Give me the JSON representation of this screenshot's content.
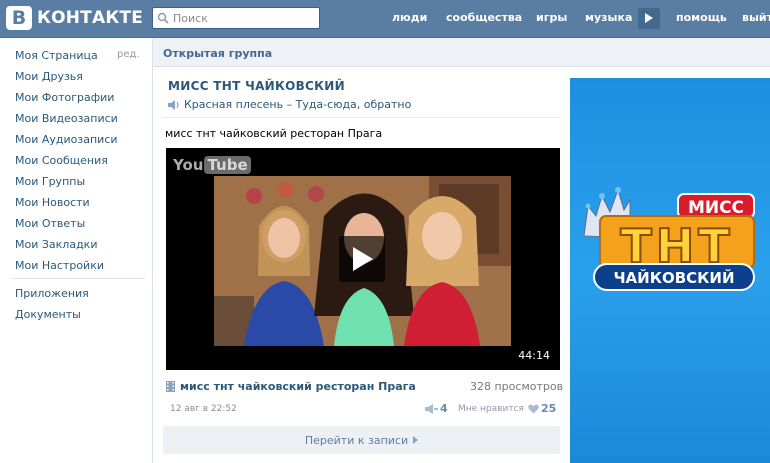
{
  "header": {
    "logo_letter": "В",
    "logo_text": "КОНТАКТЕ",
    "search_placeholder": "Поиск",
    "nav": [
      "люди",
      "сообщества",
      "игры",
      "музыка",
      "помощь",
      "выйти"
    ]
  },
  "sidebar": {
    "edit_label": "ред.",
    "items": [
      "Моя Страница",
      "Мои Друзья",
      "Мои Фотографии",
      "Мои Видеозаписи",
      "Мои Аудиозаписи",
      "Мои Сообщения",
      "Мои Группы",
      "Мои Новости",
      "Мои Ответы",
      "Мои Закладки",
      "Мои Настройки"
    ],
    "extra_items": [
      "Приложения",
      "Документы"
    ]
  },
  "breadcrumb": {
    "title": "Открытая группа"
  },
  "group": {
    "name": "МИСС ТНТ ЧАЙКОВСКИЙ",
    "status": "Красная плесень – Туда-сюда, обратно"
  },
  "post": {
    "text": "мисс тнт чайковский ресторан Прага",
    "video": {
      "yt_you": "You",
      "yt_tube": "Tube",
      "duration": "44:14",
      "title": "мисс тнт чайковский ресторан Прага",
      "views": "328 просмотров"
    },
    "date": "12 авг в 22:52",
    "shares": "4",
    "likes_label": "Мне нравится",
    "likes": "25",
    "goto_label": "Перейти к записи"
  },
  "banner": {
    "miss": "МИСС",
    "tnt": "ТНТ",
    "city": "ЧАЙКОВСКИЙ"
  },
  "colors": {
    "header": "#597da3",
    "link": "#2b587a",
    "banner": "#2aa0ec"
  }
}
